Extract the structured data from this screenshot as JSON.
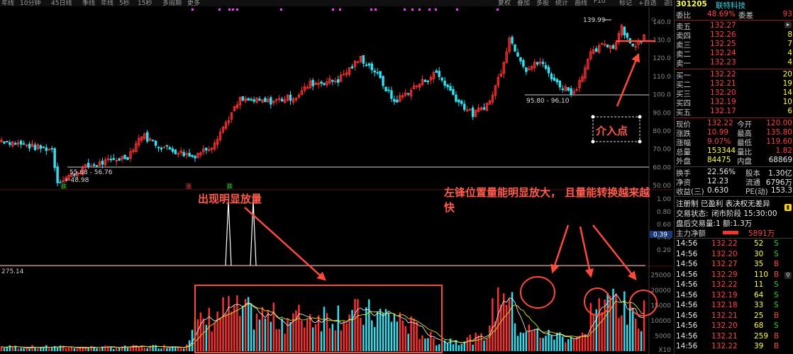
{
  "stock": {
    "code": "301205",
    "name": "联特科技",
    "weibi_label": "委比",
    "weibi_value": "48.69%",
    "weicha_label": "委差",
    "weicha_value": "93"
  },
  "order_book": {
    "asks": [
      {
        "label": "卖五",
        "price": "132.27",
        "vol": "5"
      },
      {
        "label": "卖四",
        "price": "132.26",
        "vol": "8"
      },
      {
        "label": "卖三",
        "price": "132.25",
        "vol": "7"
      },
      {
        "label": "卖二",
        "price": "132.24",
        "vol": "4"
      },
      {
        "label": "卖一",
        "price": "132.23",
        "vol": "4"
      }
    ],
    "bids": [
      {
        "label": "买一",
        "price": "132.22",
        "vol": "20"
      },
      {
        "label": "买二",
        "price": "132.21",
        "vol": "19"
      },
      {
        "label": "买三",
        "price": "132.20",
        "vol": "14"
      },
      {
        "label": "买四",
        "price": "132.19",
        "vol": "10"
      },
      {
        "label": "买五",
        "price": "132.17",
        "vol": "6"
      }
    ]
  },
  "stats": [
    {
      "l1": "现价",
      "v1": "132.22",
      "l2": "今开",
      "v2": "120.00"
    },
    {
      "l1": "涨跌",
      "v1": "10.99",
      "l2": "最高",
      "v2": "135.80"
    },
    {
      "l1": "涨幅",
      "v1": "9.07%",
      "l2": "最低",
      "v2": "119.60"
    },
    {
      "l1": "总量",
      "v1": "153344",
      "l2": "量比",
      "v2": "1.82"
    },
    {
      "l1": "外盘",
      "v1": "84475",
      "l2": "内盘",
      "v2": "68869"
    }
  ],
  "stats2": [
    {
      "l1": "换手",
      "v1": "22.56%",
      "l2": "股本",
      "v2": "1.30亿"
    },
    {
      "l1": "净资",
      "v1": "12.23",
      "l2": "流通",
      "v2": "6796万"
    },
    {
      "l1": "收益(三)",
      "v1": "0.630",
      "l2": "PE(动)",
      "v2": "153.3"
    }
  ],
  "info": {
    "line1": "注册制 已盈利 表决权无差异",
    "line2_label": "交易状态:",
    "line2_value": "闭市阶段 15:30:00",
    "line3": "盘后交易量:1  额:1.3万",
    "net_label": "主力净额",
    "net_value": "5891万"
  },
  "ticks": [
    {
      "t": "14:56",
      "p": "132.22",
      "v": "52",
      "d": "S"
    },
    {
      "t": "14:56",
      "p": "132.20",
      "v": "30",
      "d": "S"
    },
    {
      "t": "14:56",
      "p": "132.27",
      "v": "35",
      "d": "B"
    },
    {
      "t": "14:56",
      "p": "132.29",
      "v": "110",
      "d": "B"
    },
    {
      "t": "14:56",
      "p": "132.22",
      "v": "11",
      "d": "S"
    },
    {
      "t": "14:56",
      "p": "132.19",
      "v": "64",
      "d": "S"
    },
    {
      "t": "14:56",
      "p": "132.18",
      "v": "33",
      "d": "S"
    },
    {
      "t": "14:56",
      "p": "132.21",
      "v": "25",
      "d": "B"
    },
    {
      "t": "14:56",
      "p": "132.20",
      "v": "68",
      "d": "S"
    },
    {
      "t": "14:56",
      "p": "132.21",
      "v": "259",
      "d": "B"
    },
    {
      "t": "14:56",
      "p": "132.22",
      "v": "39",
      "d": "B"
    }
  ],
  "chart_data": {
    "type": "candlestick",
    "price_axis": [
      "140.0",
      "130.0",
      "120.0",
      "110.0",
      "100.0",
      "90.00",
      "80.00",
      "70.00",
      "60.00",
      "50.00"
    ],
    "price_ylim": [
      50,
      145
    ],
    "indicator_axis": [
      "1.00",
      "0.80",
      "0.60",
      "0.40",
      "0.20"
    ],
    "indicator_marker": "0.39",
    "volume_axis": [
      "25000",
      "20000",
      "15000",
      "10000",
      "5000"
    ],
    "volume_unit": "X10",
    "volume_ylim": [
      0,
      27000
    ],
    "volume_header": "275.14",
    "annotations": {
      "low": "55.68 - 56.76",
      "low_point": "←48.98",
      "gap": "95.80 - 96.10",
      "high": "139.99",
      "markers": [
        "跌",
        "涨",
        "跌"
      ]
    },
    "price_key_points": [
      {
        "i": 0,
        "close": 75
      },
      {
        "i": 12,
        "close": 71
      },
      {
        "i": 18,
        "close": 70
      },
      {
        "i": 20,
        "close": 52
      },
      {
        "i": 30,
        "close": 60
      },
      {
        "i": 45,
        "close": 66
      },
      {
        "i": 50,
        "close": 78
      },
      {
        "i": 56,
        "close": 72
      },
      {
        "i": 68,
        "close": 66
      },
      {
        "i": 75,
        "close": 72
      },
      {
        "i": 85,
        "close": 97
      },
      {
        "i": 95,
        "close": 96
      },
      {
        "i": 105,
        "close": 99
      },
      {
        "i": 110,
        "close": 106
      },
      {
        "i": 120,
        "close": 108
      },
      {
        "i": 128,
        "close": 120
      },
      {
        "i": 133,
        "close": 113
      },
      {
        "i": 140,
        "close": 96
      },
      {
        "i": 148,
        "close": 105
      },
      {
        "i": 155,
        "close": 112
      },
      {
        "i": 163,
        "close": 96
      },
      {
        "i": 168,
        "close": 89
      },
      {
        "i": 174,
        "close": 96
      },
      {
        "i": 178,
        "close": 113
      },
      {
        "i": 181,
        "close": 131
      },
      {
        "i": 187,
        "close": 114
      },
      {
        "i": 192,
        "close": 118
      },
      {
        "i": 198,
        "close": 106
      },
      {
        "i": 204,
        "close": 101
      },
      {
        "i": 210,
        "close": 122
      },
      {
        "i": 215,
        "close": 128
      },
      {
        "i": 218,
        "close": 126
      },
      {
        "i": 221,
        "close": 138
      },
      {
        "i": 223,
        "close": 131
      },
      {
        "i": 226,
        "close": 126
      },
      {
        "i": 229,
        "close": 132
      }
    ],
    "volume_key_points": [
      {
        "i": 0,
        "v": 1500
      },
      {
        "i": 40,
        "v": 1300
      },
      {
        "i": 65,
        "v": 1800
      },
      {
        "i": 68,
        "v": 8000
      },
      {
        "i": 80,
        "v": 14000
      },
      {
        "i": 100,
        "v": 11000
      },
      {
        "i": 120,
        "v": 13000
      },
      {
        "i": 140,
        "v": 12000
      },
      {
        "i": 155,
        "v": 3500
      },
      {
        "i": 172,
        "v": 4500
      },
      {
        "i": 179,
        "v": 24000
      },
      {
        "i": 184,
        "v": 8000
      },
      {
        "i": 195,
        "v": 5500
      },
      {
        "i": 208,
        "v": 5000
      },
      {
        "i": 211,
        "v": 17000
      },
      {
        "i": 215,
        "v": 14000
      },
      {
        "i": 219,
        "v": 21000
      },
      {
        "i": 223,
        "v": 12000
      },
      {
        "i": 229,
        "v": 13000
      }
    ],
    "candle_count": 230,
    "colors": {
      "up": "#ff3030",
      "down": "#30e0f0",
      "ma1": "#e8e8e8",
      "ma2": "#e8e020",
      "background": "#000000"
    }
  },
  "annotations_text": {
    "volume_note": "出现明显放量",
    "left_peak_note_1": "左锋位置量能明显放大，  且量能转换越来越",
    "left_peak_note_2": "快",
    "entry_point": "介入点"
  },
  "toolbar": {
    "left_items": [
      "年线",
      "10分钟",
      "45日线",
      "季线",
      "年线",
      "5秒",
      "15秒",
      "多周期",
      "更多"
    ],
    "right_items": [
      "复权",
      "叠加",
      "多股",
      "统计",
      "画线",
      "F10",
      "标记",
      "+自选",
      "返回"
    ]
  }
}
